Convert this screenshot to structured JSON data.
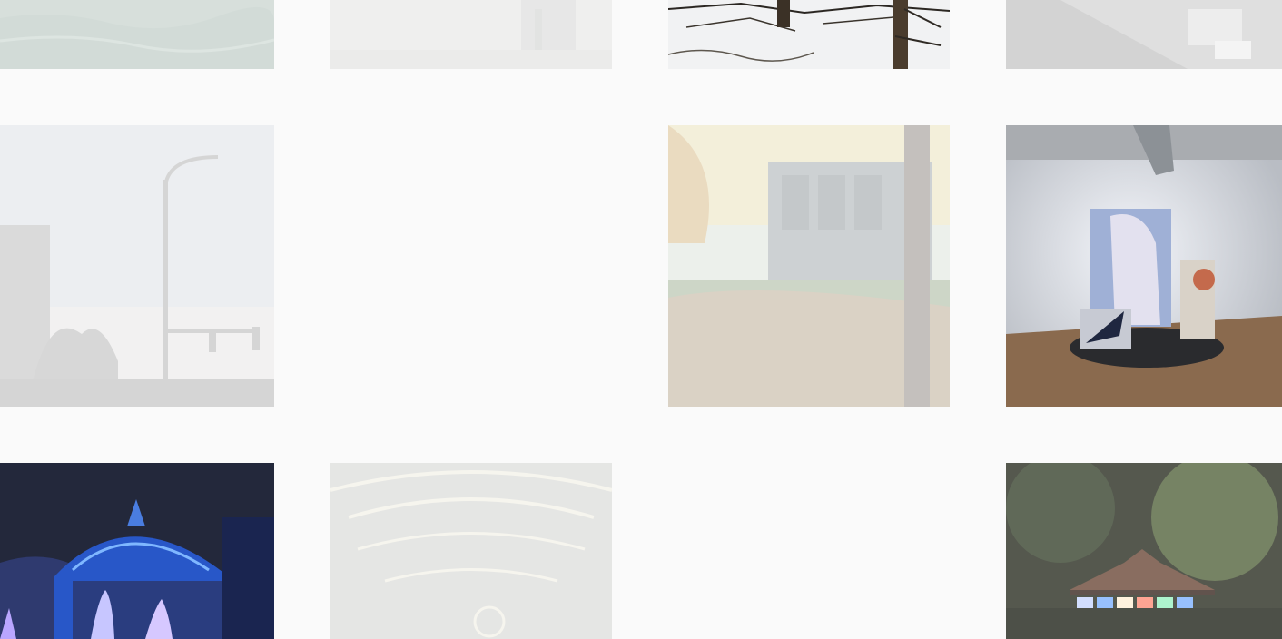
{
  "gallery": {
    "background": "#fafafa",
    "rows": [
      {
        "tiles": [
          {
            "name": "water-photo",
            "state": "faded"
          },
          {
            "name": "foggy-street-photo",
            "state": "faded"
          },
          {
            "name": "snowy-trees-photo",
            "state": "active"
          },
          {
            "name": "snowy-sidewalk-photo",
            "state": "faded"
          }
        ]
      },
      {
        "tiles": [
          {
            "name": "streetlight-sky-photo",
            "state": "faded"
          },
          {
            "name": "empty-slot",
            "state": "empty"
          },
          {
            "name": "autumn-building-photo",
            "state": "faded"
          },
          {
            "name": "gallery-installation-photo",
            "state": "active"
          }
        ]
      },
      {
        "tiles": [
          {
            "name": "lit-conservatory-photo",
            "state": "active"
          },
          {
            "name": "string-lights-photo",
            "state": "faded"
          },
          {
            "name": "empty-slot",
            "state": "empty"
          },
          {
            "name": "carousel-night-photo",
            "state": "dimmed"
          }
        ]
      }
    ]
  }
}
